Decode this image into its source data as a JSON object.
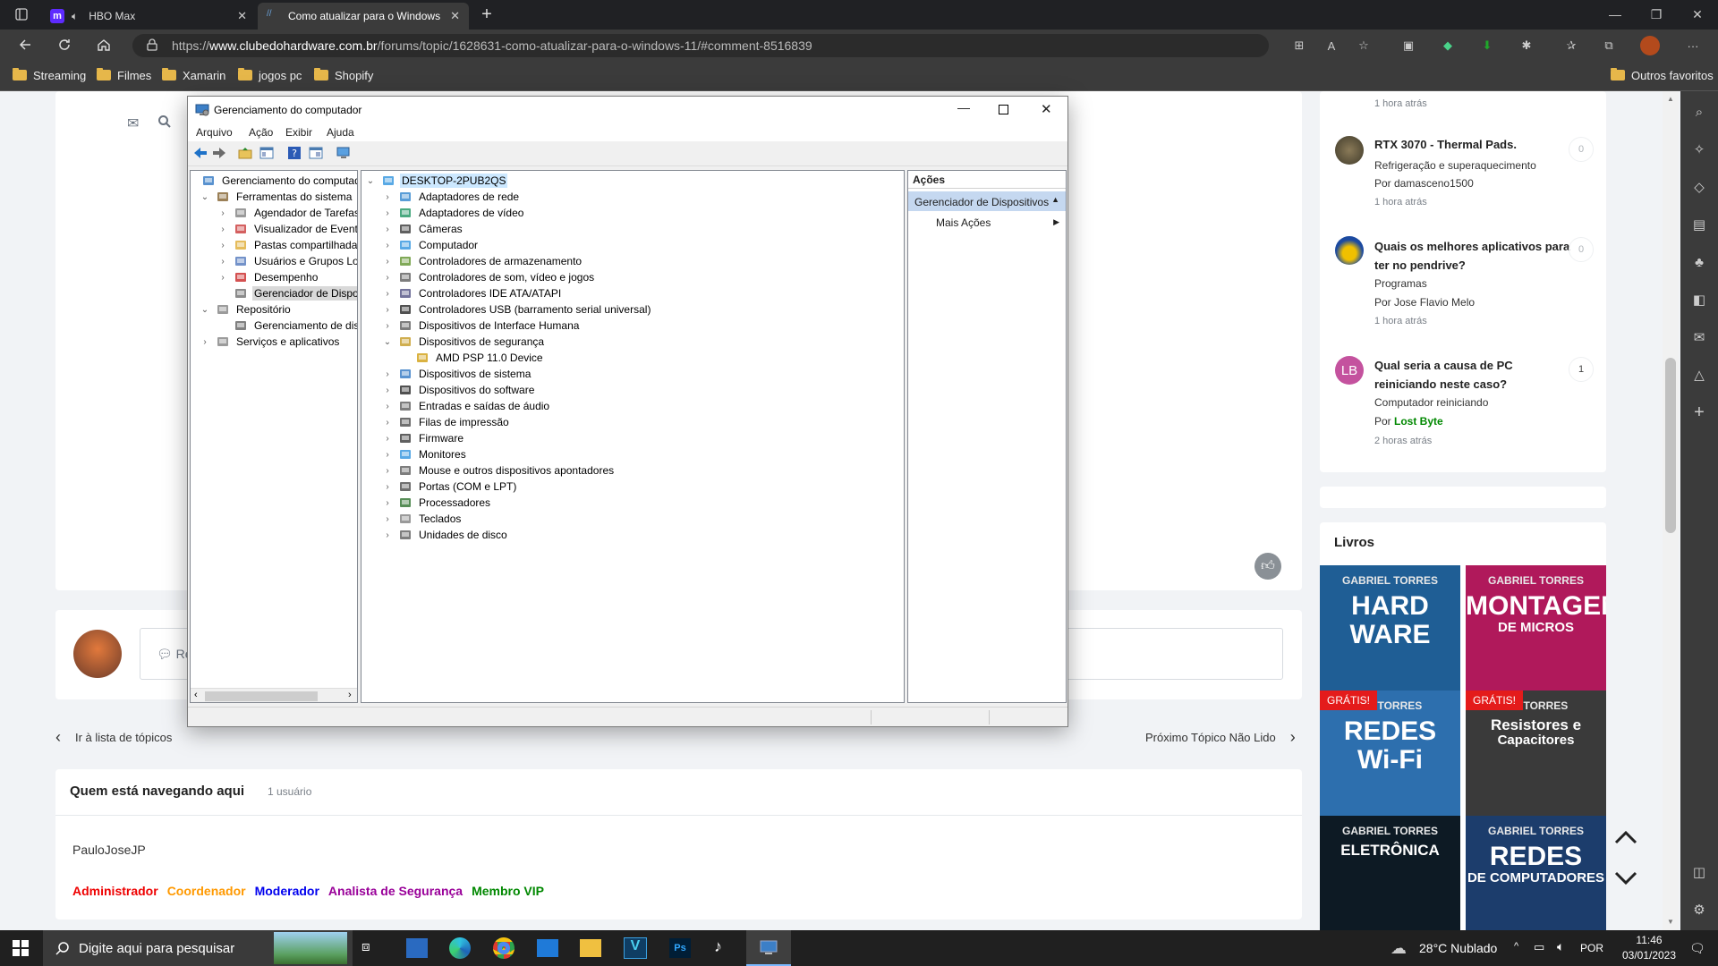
{
  "browser": {
    "tabs": [
      {
        "label": "HBO Max",
        "favicon": "hbo-max-icon"
      },
      {
        "label": "Como atualizar para o Windows",
        "favicon": "clube-do-hardware-icon"
      }
    ],
    "url_prefix": "https://",
    "url_domain": "www.clubedohardware.com.br",
    "url_path": "/forums/topic/1628631-como-atualizar-para-o-windows-11/#comment-8516839",
    "bookmarks": [
      "Streaming",
      "Filmes",
      "Xamarin",
      "jogos pc",
      "Shopify"
    ],
    "other_favorites": "Outros favoritos"
  },
  "page": {
    "reply_placeholder": "Re",
    "nav_prev": "Ir à lista de tópicos",
    "nav_next": "Próximo Tópico Não Lido",
    "browsing_title": "Quem está navegando aqui",
    "browsing_count": "1 usuário",
    "browsing_user": "PauloJoseJP",
    "roles": [
      {
        "label": "Administrador",
        "color": "#ee0000"
      },
      {
        "label": "Coordenador",
        "color": "#ff9900"
      },
      {
        "label": "Moderador",
        "color": "#0000ee"
      },
      {
        "label": "Analista de Segurança",
        "color": "#990099"
      },
      {
        "label": "Membro VIP",
        "color": "#008800"
      }
    ]
  },
  "sidebar": {
    "top_time": "1 hora atrás",
    "topics": [
      {
        "title": "RTX 3070 - Thermal Pads.",
        "forum": "Refrigeração e superaquecimento",
        "by": "Por damasceno1500",
        "by_colored": "",
        "time": "1 hora atrás",
        "count": "0"
      },
      {
        "title": "Quais os melhores aplicativos para ter no pendrive?",
        "forum": "Programas",
        "by": "Por Jose Flavio Melo",
        "by_colored": "",
        "time": "1 hora atrás",
        "count": "0"
      },
      {
        "title": "Qual seria a causa de PC reiniciando neste caso?",
        "forum": "Computador reiniciando",
        "by": "Por ",
        "by_colored": "Lost Byte",
        "time": "2 horas atrás",
        "count": "1",
        "avatar_text": "LB"
      }
    ],
    "books_title": "Livros",
    "books": [
      {
        "author": "GABRIEL TORRES",
        "title1": "HARD",
        "title2": "WARE",
        "badge": "",
        "bg": "#1f5e95"
      },
      {
        "author": "GABRIEL TORRES",
        "title1": "MONTAGEM",
        "title2": "DE MICROS",
        "badge": "",
        "bg": "#b0195b"
      },
      {
        "author": "IEL TORRES",
        "title1": "REDES",
        "title2": "Wi-Fi",
        "badge": "GRÁTIS!",
        "bg": "#2d6fae"
      },
      {
        "author": "IEL TORRES",
        "title1": "Resistores e",
        "title2": "Capacitores",
        "badge": "GRÁTIS!",
        "bg": "#3a3a3a"
      },
      {
        "author": "GABRIEL TORRES",
        "title1": "ELETRÔNICA",
        "title2": "",
        "badge": "",
        "bg": "#0d1a24"
      },
      {
        "author": "GABRIEL TORRES",
        "title1": "REDES",
        "title2": "DE COMPUTADORES",
        "badge": "",
        "bg": "#1c3d6c"
      }
    ]
  },
  "dialog": {
    "title": "Gerenciamento do computador",
    "menu": [
      "Arquivo",
      "Ação",
      "Exibir",
      "Ajuda"
    ],
    "left_tree": [
      {
        "label": "Gerenciamento do computado",
        "level": 0,
        "exp": "",
        "icon": "computer-management-icon"
      },
      {
        "label": "Ferramentas do sistema",
        "level": 1,
        "exp": "v",
        "icon": "tools-icon"
      },
      {
        "label": "Agendador de Tarefas",
        "level": 2,
        "exp": ">",
        "icon": "clock-icon"
      },
      {
        "label": "Visualizador de Eventos",
        "level": 2,
        "exp": ">",
        "icon": "event-viewer-icon"
      },
      {
        "label": "Pastas compartilhadas",
        "level": 2,
        "exp": ">",
        "icon": "shared-folder-icon"
      },
      {
        "label": "Usuários e Grupos Loca",
        "level": 2,
        "exp": ">",
        "icon": "users-icon"
      },
      {
        "label": "Desempenho",
        "level": 2,
        "exp": ">",
        "icon": "performance-icon"
      },
      {
        "label": "Gerenciador de Disposit",
        "level": 2,
        "exp": "",
        "icon": "device-manager-icon",
        "selected": true
      },
      {
        "label": "Repositório",
        "level": 1,
        "exp": "v",
        "icon": "storage-icon"
      },
      {
        "label": "Gerenciamento de disco",
        "level": 2,
        "exp": "",
        "icon": "disk-icon"
      },
      {
        "label": "Serviços e aplicativos",
        "level": 1,
        "exp": ">",
        "icon": "services-icon"
      }
    ],
    "device_root": "DESKTOP-2PUB2QS",
    "devices": [
      {
        "label": "Adaptadores de rede",
        "exp": ">",
        "icon": "network-adapter-icon",
        "level": 1
      },
      {
        "label": "Adaptadores de vídeo",
        "exp": ">",
        "icon": "display-adapter-icon",
        "level": 1
      },
      {
        "label": "Câmeras",
        "exp": ">",
        "icon": "camera-icon",
        "level": 1
      },
      {
        "label": "Computador",
        "exp": ">",
        "icon": "computer-icon",
        "level": 1
      },
      {
        "label": "Controladores de armazenamento",
        "exp": ">",
        "icon": "storage-controller-icon",
        "level": 1
      },
      {
        "label": "Controladores de som, vídeo e jogos",
        "exp": ">",
        "icon": "sound-icon",
        "level": 1
      },
      {
        "label": "Controladores IDE ATA/ATAPI",
        "exp": ">",
        "icon": "ide-icon",
        "level": 1
      },
      {
        "label": "Controladores USB (barramento serial universal)",
        "exp": ">",
        "icon": "usb-icon",
        "level": 1
      },
      {
        "label": "Dispositivos de Interface Humana",
        "exp": ">",
        "icon": "hid-icon",
        "level": 1
      },
      {
        "label": "Dispositivos de segurança",
        "exp": "v",
        "icon": "security-device-icon",
        "level": 1
      },
      {
        "label": "AMD PSP 11.0 Device",
        "exp": "",
        "icon": "security-key-icon",
        "level": 2
      },
      {
        "label": "Dispositivos de sistema",
        "exp": ">",
        "icon": "system-device-icon",
        "level": 1
      },
      {
        "label": "Dispositivos do software",
        "exp": ">",
        "icon": "software-device-icon",
        "level": 1
      },
      {
        "label": "Entradas e saídas de áudio",
        "exp": ">",
        "icon": "audio-io-icon",
        "level": 1
      },
      {
        "label": "Filas de impressão",
        "exp": ">",
        "icon": "printer-icon",
        "level": 1
      },
      {
        "label": "Firmware",
        "exp": ">",
        "icon": "firmware-icon",
        "level": 1
      },
      {
        "label": "Monitores",
        "exp": ">",
        "icon": "monitor-icon",
        "level": 1
      },
      {
        "label": "Mouse e outros dispositivos apontadores",
        "exp": ">",
        "icon": "mouse-icon",
        "level": 1
      },
      {
        "label": "Portas (COM e LPT)",
        "exp": ">",
        "icon": "port-icon",
        "level": 1
      },
      {
        "label": "Processadores",
        "exp": ">",
        "icon": "processor-icon",
        "level": 1
      },
      {
        "label": "Teclados",
        "exp": ">",
        "icon": "keyboard-icon",
        "level": 1
      },
      {
        "label": "Unidades de disco",
        "exp": ">",
        "icon": "disk-drive-icon",
        "level": 1
      }
    ],
    "actions_header": "Ações",
    "actions_section": "Gerenciador de Dispositivos",
    "actions_more": "Mais Ações"
  },
  "taskbar": {
    "search_placeholder": "Digite aqui para pesquisar",
    "weather": "28°C  Nublado",
    "lang": "POR",
    "time": "11:46",
    "date": "03/01/2023"
  }
}
